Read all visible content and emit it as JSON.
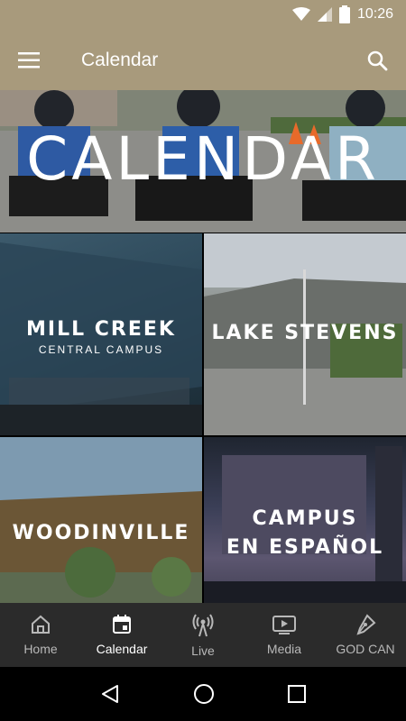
{
  "status": {
    "time": "10:26"
  },
  "app_bar": {
    "title": "Calendar"
  },
  "hero": {
    "title": "CALENDAR"
  },
  "tiles": [
    {
      "name": "MILL CREEK",
      "subtitle": "CENTRAL CAMPUS"
    },
    {
      "name": "LAKE STEVENS"
    },
    {
      "name": "WOODINVILLE"
    },
    {
      "name_line1": "CAMPUS",
      "name_line2": "EN ESPAÑOL"
    }
  ],
  "bottom_nav": {
    "items": [
      {
        "label": "Home",
        "icon": "home-icon"
      },
      {
        "label": "Calendar",
        "icon": "calendar-icon",
        "active": true
      },
      {
        "label": "Live",
        "icon": "broadcast-icon"
      },
      {
        "label": "Media",
        "icon": "video-icon"
      },
      {
        "label": "GOD CAN",
        "icon": "pen-icon"
      }
    ]
  },
  "colors": {
    "app_bar": "#a89a7c",
    "bottom_nav": "#2b2b2b"
  }
}
